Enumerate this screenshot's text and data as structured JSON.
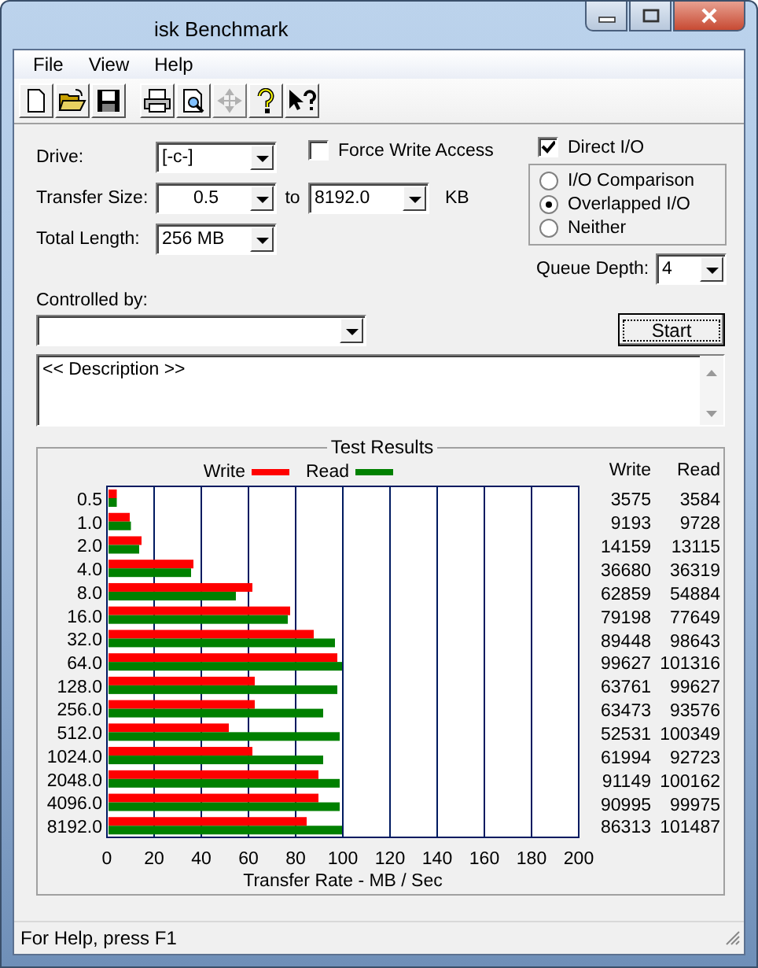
{
  "window": {
    "title": "isk Benchmark"
  },
  "menu": [
    {
      "label": "File"
    },
    {
      "label": "View"
    },
    {
      "label": "Help"
    }
  ],
  "toolbar": [
    {
      "kind": "new",
      "disabled": false
    },
    {
      "kind": "open",
      "disabled": false
    },
    {
      "kind": "save",
      "disabled": false
    },
    {
      "kind": "print",
      "disabled": false
    },
    {
      "kind": "preview",
      "disabled": false
    },
    {
      "kind": "move",
      "disabled": true
    },
    {
      "kind": "help",
      "disabled": false
    },
    {
      "kind": "context_help",
      "disabled": false
    }
  ],
  "form": {
    "drive": {
      "label": "Drive:",
      "value": "[-c-]"
    },
    "transfer_size": {
      "label": "Transfer Size:",
      "from": "0.5",
      "to_label": "to",
      "to": "8192.0",
      "unit": "KB"
    },
    "total_length": {
      "label": "Total Length:",
      "value": "256 MB"
    },
    "force_write_access": {
      "label": "Force Write Access",
      "checked": false
    },
    "direct_io": {
      "label": "Direct I/O",
      "checked": true
    },
    "io_modes": [
      {
        "label": "I/O Comparison",
        "selected": false
      },
      {
        "label": "Overlapped I/O",
        "selected": true
      },
      {
        "label": "Neither",
        "selected": false
      }
    ],
    "queue_depth": {
      "label": "Queue Depth:",
      "value": "4"
    },
    "controlled_by": {
      "label": "Controlled by:"
    },
    "start_button": "Start",
    "description": "<< Description >>"
  },
  "test_results": {
    "title": "Test Results",
    "chart_data": {
      "type": "bar",
      "orientation": "horizontal",
      "grid": true,
      "legend": true,
      "xlabel": "Transfer Rate - MB / Sec",
      "categories": [
        "0.5",
        "1.0",
        "2.0",
        "4.0",
        "8.0",
        "16.0",
        "32.0",
        "64.0",
        "128.0",
        "256.0",
        "512.0",
        "1024.0",
        "2048.0",
        "4096.0",
        "8192.0"
      ],
      "xlim": [
        0,
        200
      ],
      "xticks": [
        0,
        20,
        40,
        60,
        80,
        100,
        120,
        140,
        160,
        180,
        200
      ],
      "series": [
        {
          "name": "Write",
          "color": "#ff0000",
          "values": [
            3.5,
            9,
            14,
            36,
            61,
            77,
            87,
            97,
            62,
            62,
            51,
            61,
            89,
            89,
            84
          ]
        },
        {
          "name": "Read",
          "color": "#008000",
          "values": [
            3.5,
            9.5,
            13,
            35,
            54,
            76,
            96,
            99,
            97,
            91,
            98,
            91,
            98,
            98,
            99
          ]
        }
      ]
    },
    "table": {
      "columns": [
        "Write",
        "Read"
      ],
      "rows": [
        [
          "3575",
          "3584"
        ],
        [
          "9193",
          "9728"
        ],
        [
          "14159",
          "13115"
        ],
        [
          "36680",
          "36319"
        ],
        [
          "62859",
          "54884"
        ],
        [
          "79198",
          "77649"
        ],
        [
          "89448",
          "98643"
        ],
        [
          "99627",
          "101316"
        ],
        [
          "63761",
          "99627"
        ],
        [
          "63473",
          "93576"
        ],
        [
          "52531",
          "100349"
        ],
        [
          "61994",
          "92723"
        ],
        [
          "91149",
          "100162"
        ],
        [
          "90995",
          "99975"
        ],
        [
          "86313",
          "101487"
        ]
      ]
    }
  },
  "status_bar": "For Help, press F1"
}
